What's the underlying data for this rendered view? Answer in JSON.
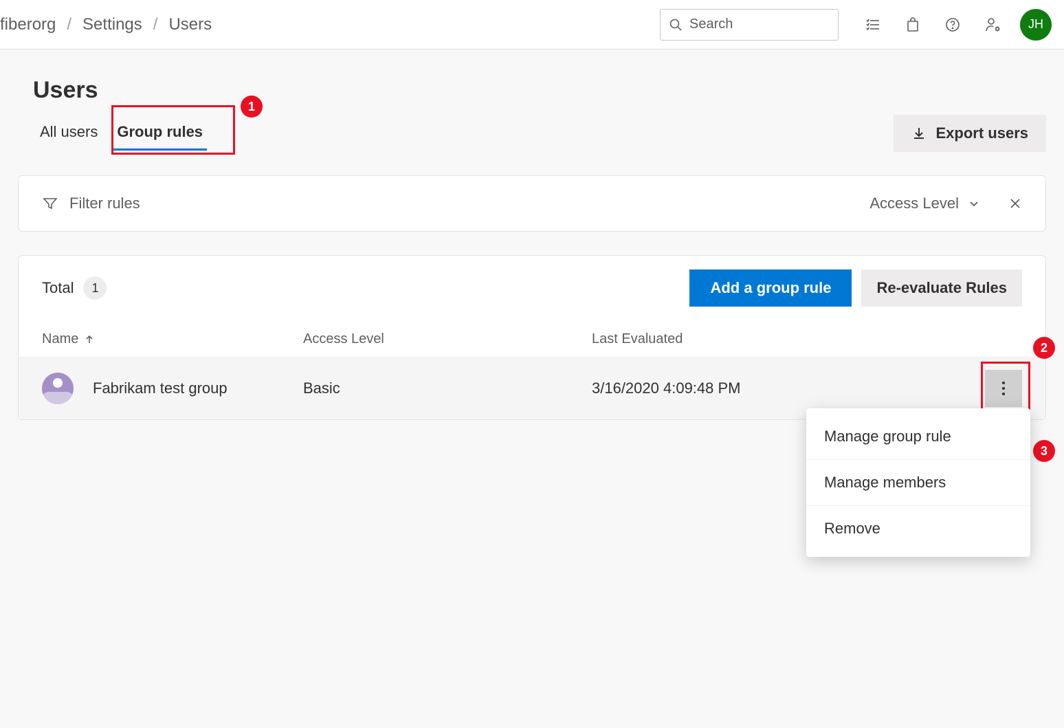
{
  "breadcrumb": {
    "items": [
      "fiberorg",
      "Settings",
      "Users"
    ]
  },
  "search": {
    "placeholder": "Search"
  },
  "avatar": {
    "initials": "JH"
  },
  "page": {
    "title": "Users"
  },
  "tabs": {
    "all_users": "All users",
    "group_rules": "Group rules"
  },
  "export_label": "Export users",
  "filter": {
    "placeholder": "Filter rules",
    "access_level": "Access Level"
  },
  "table": {
    "total_label": "Total",
    "total_count": "1",
    "add_rule": "Add a group rule",
    "reeval": "Re-evaluate Rules",
    "columns": {
      "name": "Name",
      "access": "Access Level",
      "last": "Last Evaluated"
    },
    "rows": [
      {
        "name": "Fabrikam test group",
        "access": "Basic",
        "last": "3/16/2020 4:09:48 PM"
      }
    ]
  },
  "menu": {
    "manage_rule": "Manage group rule",
    "manage_members": "Manage members",
    "remove": "Remove"
  },
  "callouts": {
    "c1": "1",
    "c2": "2",
    "c3": "3"
  }
}
